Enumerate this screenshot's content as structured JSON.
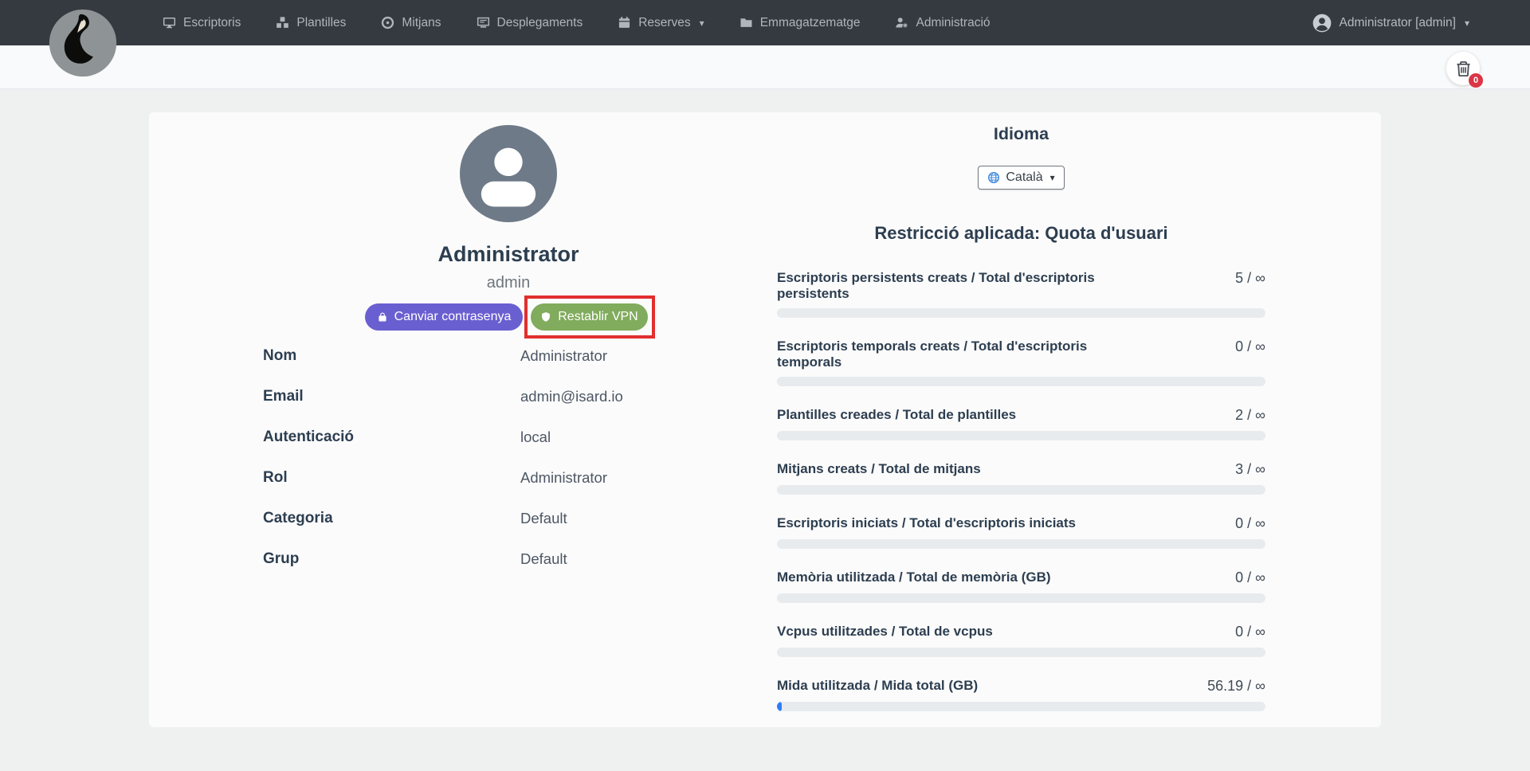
{
  "navbar": {
    "items": [
      {
        "label": "Escriptoris",
        "icon": "desktop-icon",
        "dropdown": false
      },
      {
        "label": "Plantilles",
        "icon": "cubes-icon",
        "dropdown": false
      },
      {
        "label": "Mitjans",
        "icon": "disc-icon",
        "dropdown": false
      },
      {
        "label": "Desplegaments",
        "icon": "deployments-icon",
        "dropdown": false
      },
      {
        "label": "Reserves",
        "icon": "calendar-icon",
        "dropdown": true
      },
      {
        "label": "Emmagatzematge",
        "icon": "folder-icon",
        "dropdown": false
      },
      {
        "label": "Administració",
        "icon": "user-gear-icon",
        "dropdown": false
      }
    ],
    "user_menu": {
      "label": "Administrator [admin]",
      "icon": "user-circle-icon",
      "dropdown": true
    }
  },
  "toolbar": {
    "trash_badge": "0"
  },
  "profile": {
    "display_name": "Administrator",
    "username": "admin",
    "buttons": {
      "change_password": "Canviar contrasenya",
      "reset_vpn": "Restablir VPN"
    },
    "fields": [
      {
        "label": "Nom",
        "value": "Administrator"
      },
      {
        "label": "Email",
        "value": "admin@isard.io"
      },
      {
        "label": "Autenticació",
        "value": "local"
      },
      {
        "label": "Rol",
        "value": "Administrator"
      },
      {
        "label": "Categoria",
        "value": "Default"
      },
      {
        "label": "Grup",
        "value": "Default"
      }
    ]
  },
  "language": {
    "title": "Idioma",
    "selected": "Català"
  },
  "quota": {
    "title": "Restricció aplicada: Quota d'usuari",
    "items": [
      {
        "label": "Escriptoris persistents creats / Total d'escriptoris persistents",
        "value": "5 / ∞",
        "percent": 0
      },
      {
        "label": "Escriptoris temporals creats / Total d'escriptoris temporals",
        "value": "0 / ∞",
        "percent": 0
      },
      {
        "label": "Plantilles creades / Total de plantilles",
        "value": "2 / ∞",
        "percent": 0
      },
      {
        "label": "Mitjans creats / Total de mitjans",
        "value": "3 / ∞",
        "percent": 0
      },
      {
        "label": "Escriptoris iniciats / Total d'escriptoris iniciats",
        "value": "0 / ∞",
        "percent": 0
      },
      {
        "label": "Memòria utilitzada / Total de memòria (GB)",
        "value": "0 / ∞",
        "percent": 0
      },
      {
        "label": "Vcpus utilitzades / Total de vcpus",
        "value": "0 / ∞",
        "percent": 0
      },
      {
        "label": "Mida utilitzada / Mida total (GB)",
        "value": "56.19 / ∞",
        "percent": 0.9
      }
    ]
  },
  "colors": {
    "navbar_bg": "#343a40",
    "accent_purple": "#6a5fd1",
    "accent_green": "#81ab5d",
    "highlight_red": "#e12e2e",
    "progress_fill_blue": "#2e7ef7",
    "badge_red": "#dc3545",
    "globe_blue": "#4189dd"
  }
}
